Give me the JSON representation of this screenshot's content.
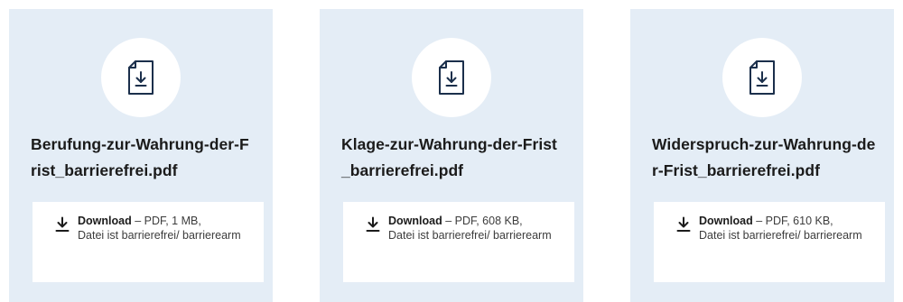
{
  "cards": [
    {
      "filename": "Berufung-zur-Wahrung-der-Frist_barrierefrei.pdf",
      "download_label": "Download",
      "download_meta": " – PDF, 1 MB,",
      "accessibility": "Datei ist barrierefrei/ barrierearm",
      "icon": "document-download-icon"
    },
    {
      "filename": "Klage-zur-Wahrung-der-Frist_barrierefrei.pdf",
      "download_label": "Download",
      "download_meta": " – PDF, 608 KB,",
      "accessibility": "Datei ist barrierefrei/ barrierearm",
      "icon": "document-download-icon"
    },
    {
      "filename": "Widerspruch-zur-Wahrung-der-Frist_barrierefrei.pdf",
      "download_label": "Download",
      "download_meta": " – PDF, 610 KB,",
      "accessibility": "Datei ist barrierefrei/ barrierearm",
      "icon": "document-download-icon"
    }
  ],
  "colors": {
    "card_background": "#e4edf6",
    "icon_accent": "#1b2f4b",
    "text": "#1b1b1b"
  }
}
